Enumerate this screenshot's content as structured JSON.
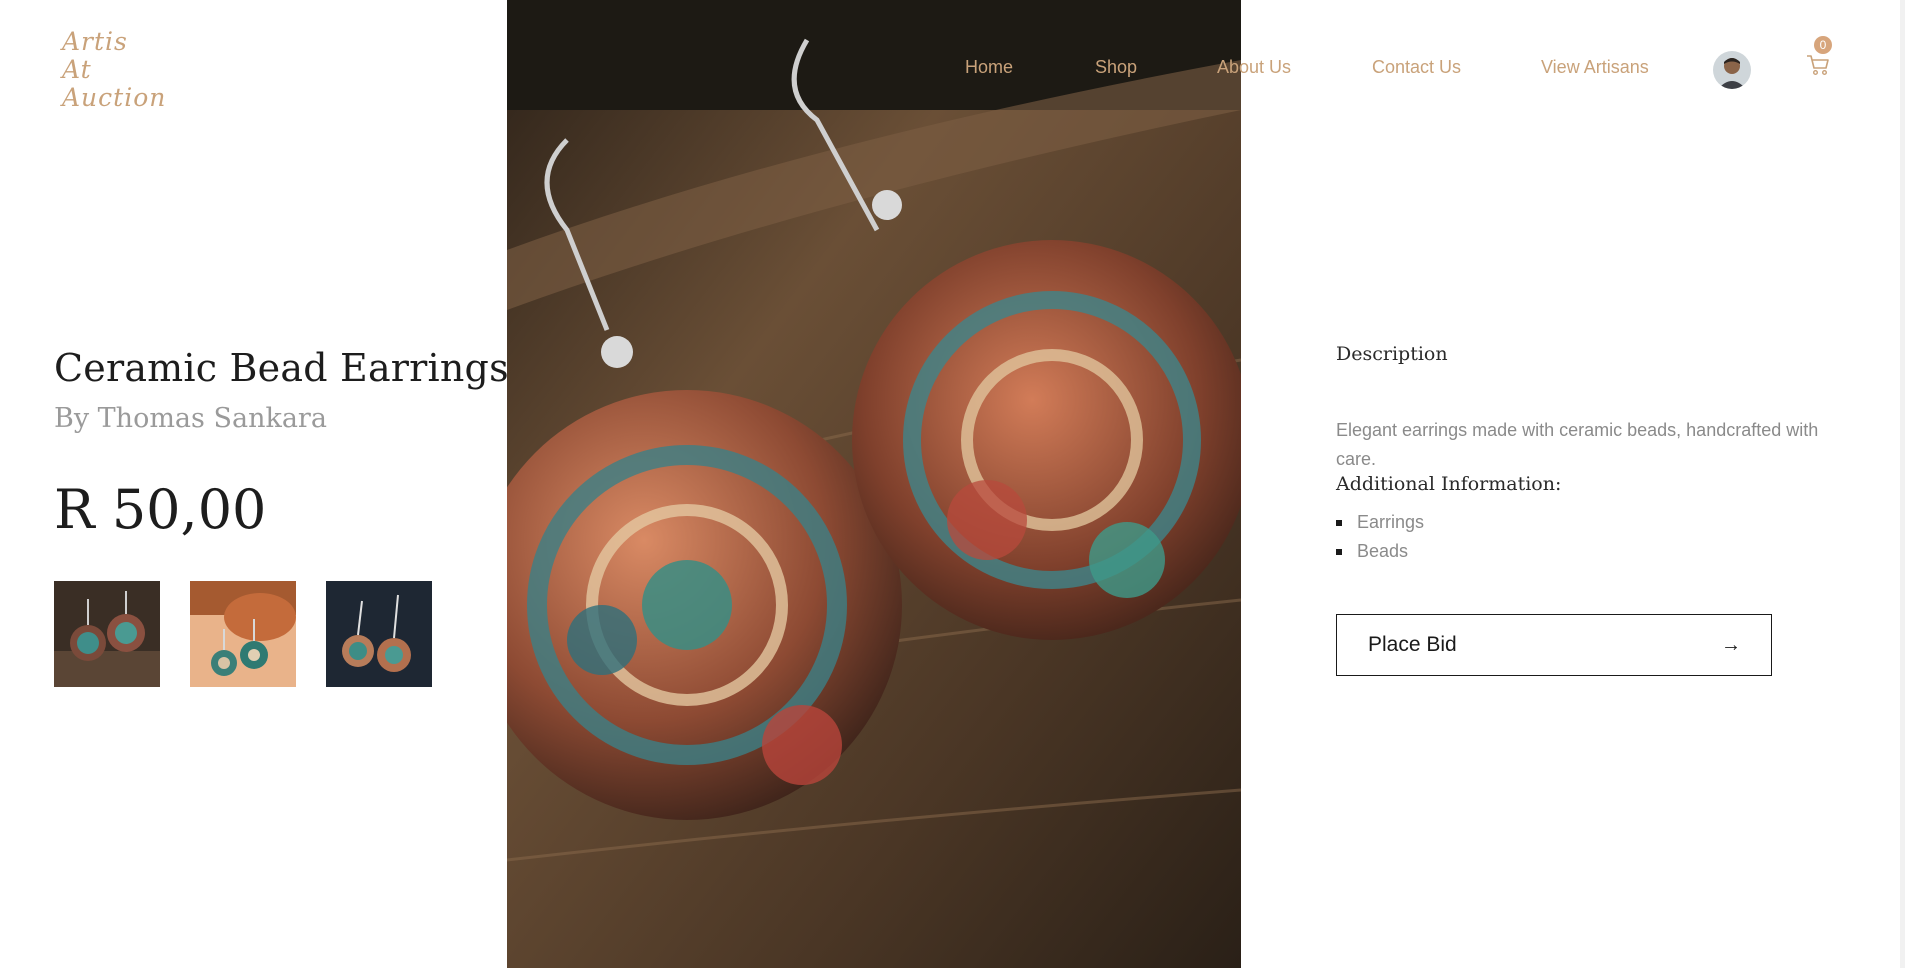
{
  "brand": {
    "logo_lines": [
      "Artis",
      "At",
      "Auction"
    ]
  },
  "nav": {
    "links": [
      "Home",
      "Shop",
      "About Us",
      "Contact Us",
      "View Artisans"
    ],
    "cart_count": "0"
  },
  "product": {
    "title": "Ceramic Bead Earrings",
    "artist": "By Thomas Sankara",
    "price": "R 50,00"
  },
  "details": {
    "description_heading": "Description",
    "description_text": "Elegant earrings made with ceramic beads, handcrafted with care.",
    "additional_heading": "Additional Information:",
    "tags": [
      "Earrings",
      "Beads"
    ]
  },
  "actions": {
    "bid_label": "Place Bid",
    "bid_arrow": "→"
  },
  "icons": {
    "cart": "shopping-cart-icon",
    "avatar": "user-avatar",
    "arrow": "arrow-right-icon"
  },
  "colors": {
    "accent": "#c9a27a",
    "badge": "#d7a57c",
    "text_dark": "#1d1d1d",
    "text_muted": "#8a8a8a"
  }
}
